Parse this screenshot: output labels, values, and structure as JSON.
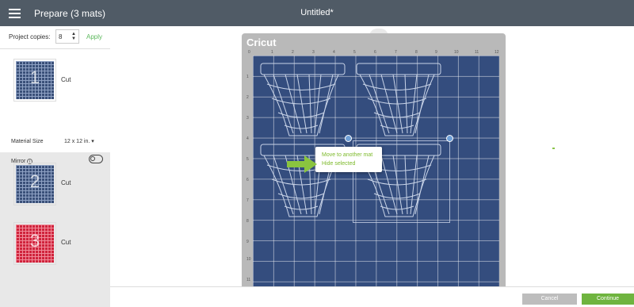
{
  "header": {
    "title": "Prepare (3 mats)",
    "document_title": "Untitled*"
  },
  "sidebar": {
    "copies_label": "Project copies:",
    "copies_value": "8",
    "apply_label": "Apply",
    "mats": [
      {
        "number": "1",
        "label": "Cut",
        "color": "#3a5079"
      },
      {
        "number": "2",
        "label": "Cut",
        "color": "#3a5079"
      },
      {
        "number": "3",
        "label": "Cut",
        "color": "#d0233c"
      }
    ],
    "material_size_label": "Material Size",
    "material_size_value": "12 x 12 in.",
    "mirror_label": "Mirror",
    "mirror_on": false
  },
  "mat": {
    "brand": "Cricut",
    "ruler_x": [
      "0",
      "1",
      "2",
      "3",
      "4",
      "5",
      "6",
      "7",
      "8",
      "9",
      "10",
      "11",
      "12"
    ],
    "ruler_y": [
      "1",
      "2",
      "3",
      "4",
      "5",
      "6",
      "7",
      "8",
      "9",
      "10",
      "11"
    ]
  },
  "context_menu": {
    "items": [
      "Move to another mat",
      "Hide selected"
    ]
  },
  "footer": {
    "cancel_label": "Cancel",
    "continue_label": "Continue"
  },
  "colors": {
    "accent_green": "#6fb43f",
    "mat_blue": "#344d7e",
    "header_bg": "#505b66"
  }
}
